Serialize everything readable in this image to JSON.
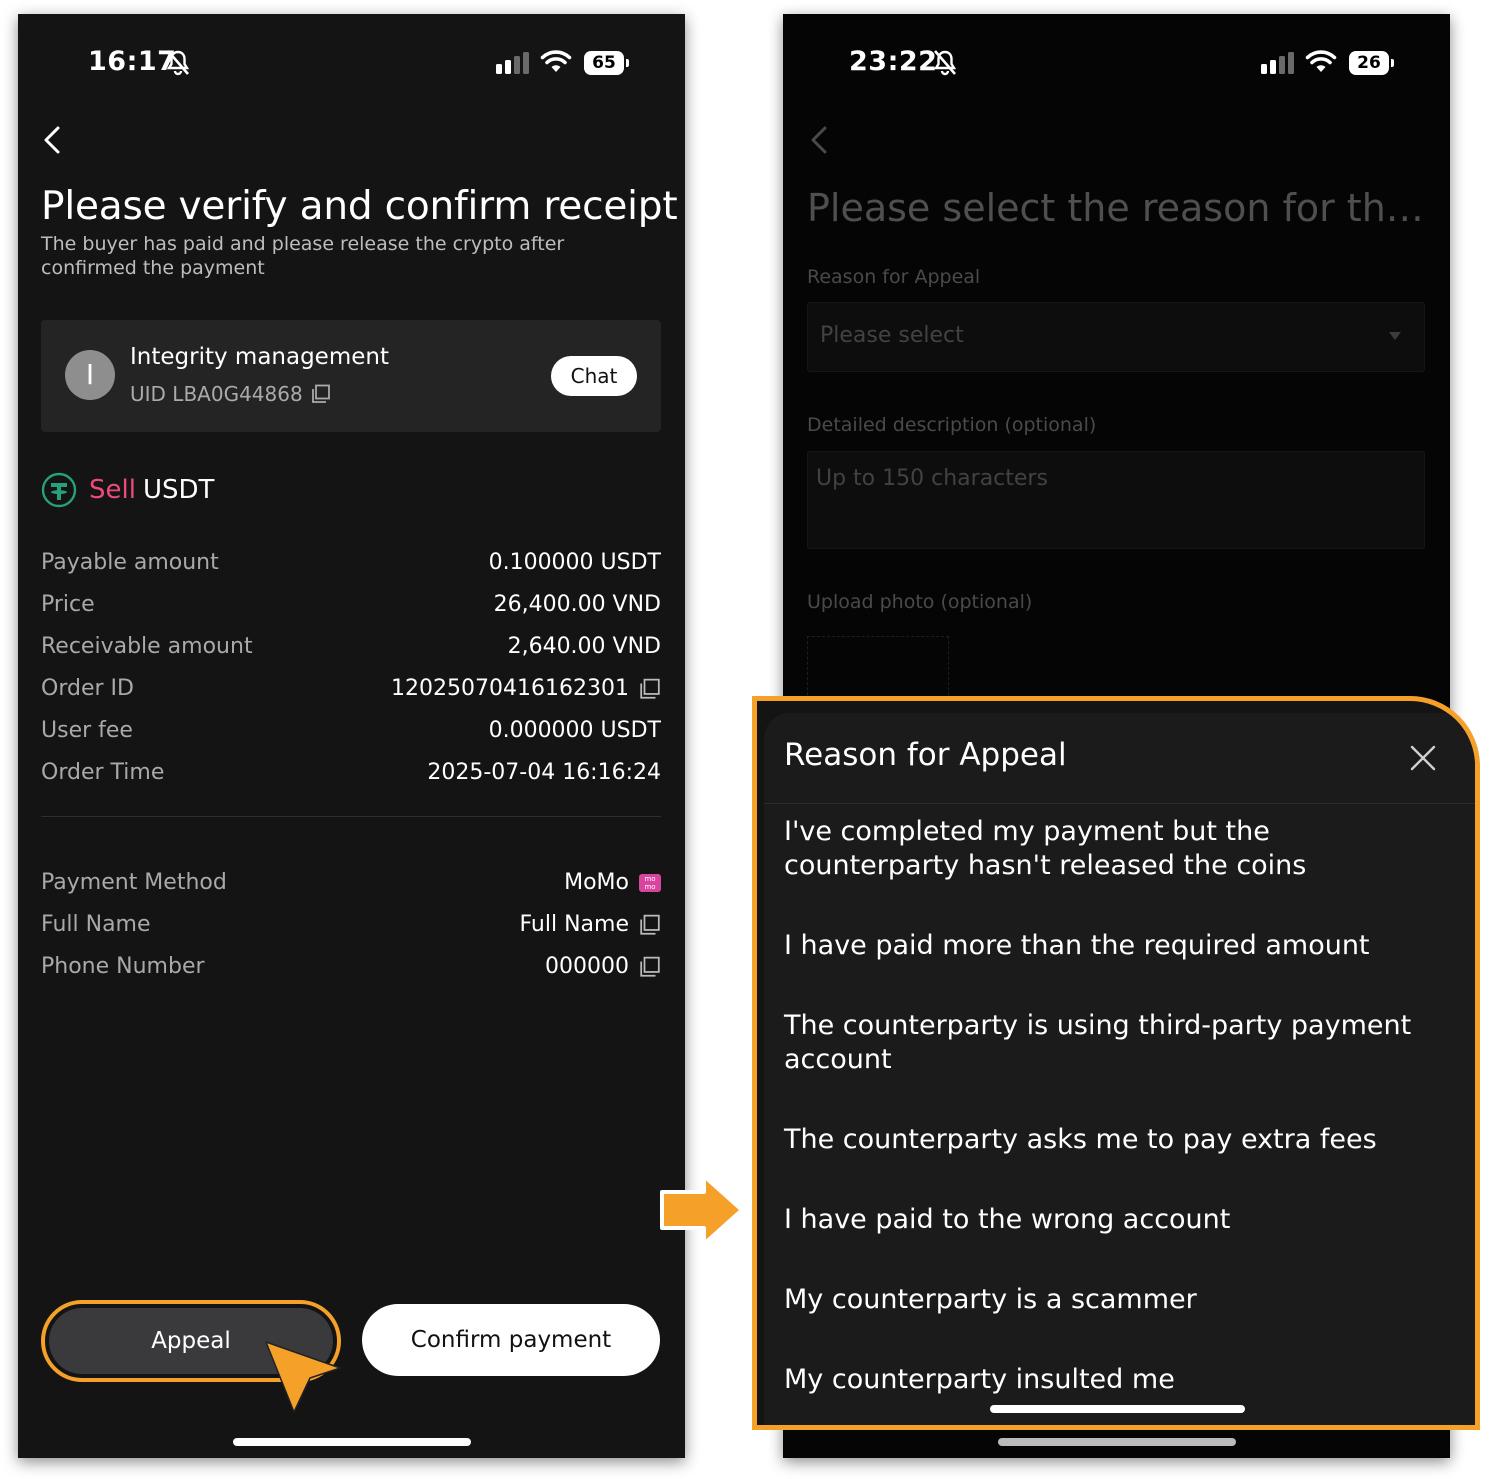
{
  "left": {
    "status": {
      "time": "16:17",
      "battery": "65"
    },
    "title": "Please verify and confirm receipt",
    "subtitle": "The buyer has paid and please release the crypto after confirmed the payment",
    "merchant": {
      "initial": "I",
      "name": "Integrity management",
      "uid": "UID LBA0G44868",
      "chat_label": "Chat"
    },
    "side": {
      "action": "Sell",
      "asset": "USDT"
    },
    "rows": [
      {
        "label": "Payable amount",
        "value": "0.100000 USDT",
        "copy": false
      },
      {
        "label": "Price",
        "value": "26,400.00 VND",
        "copy": false
      },
      {
        "label": "Receivable amount",
        "value": "2,640.00 VND",
        "copy": false
      },
      {
        "label": "Order ID",
        "value": "12025070416162301",
        "copy": true
      },
      {
        "label": "User fee",
        "value": "0.000000 USDT",
        "copy": false
      },
      {
        "label": "Order Time",
        "value": "2025-07-04 16:16:24",
        "copy": false
      }
    ],
    "pay": [
      {
        "label": "Payment Method",
        "value": "MoMo",
        "badge": true
      },
      {
        "label": "Full Name",
        "value": "Full Name",
        "copy": true
      },
      {
        "label": "Phone Number",
        "value": "000000",
        "copy": true
      }
    ],
    "appeal_label": "Appeal",
    "confirm_label": "Confirm payment"
  },
  "right": {
    "status": {
      "time": "23:22",
      "battery": "26"
    },
    "title": "Please select the reason for th…",
    "reason_label": "Reason for Appeal",
    "select_placeholder": "Please select",
    "desc_label": "Detailed description (optional)",
    "desc_placeholder": "Up to 150 characters",
    "upload_label": "Upload photo (optional)"
  },
  "sheet": {
    "title": "Reason for Appeal",
    "reasons": [
      "I've completed my payment but the counterparty hasn't released the coins",
      "I have paid more than the required amount",
      "The counterparty is using third-party payment account",
      "The counterparty asks me to pay extra fees",
      "I have paid to the wrong account",
      "My counterparty is a scammer",
      "My counterparty insulted me"
    ]
  },
  "colors": {
    "accent": "#f5a129",
    "sell": "#ef4a79",
    "tether": "#26a17b"
  }
}
